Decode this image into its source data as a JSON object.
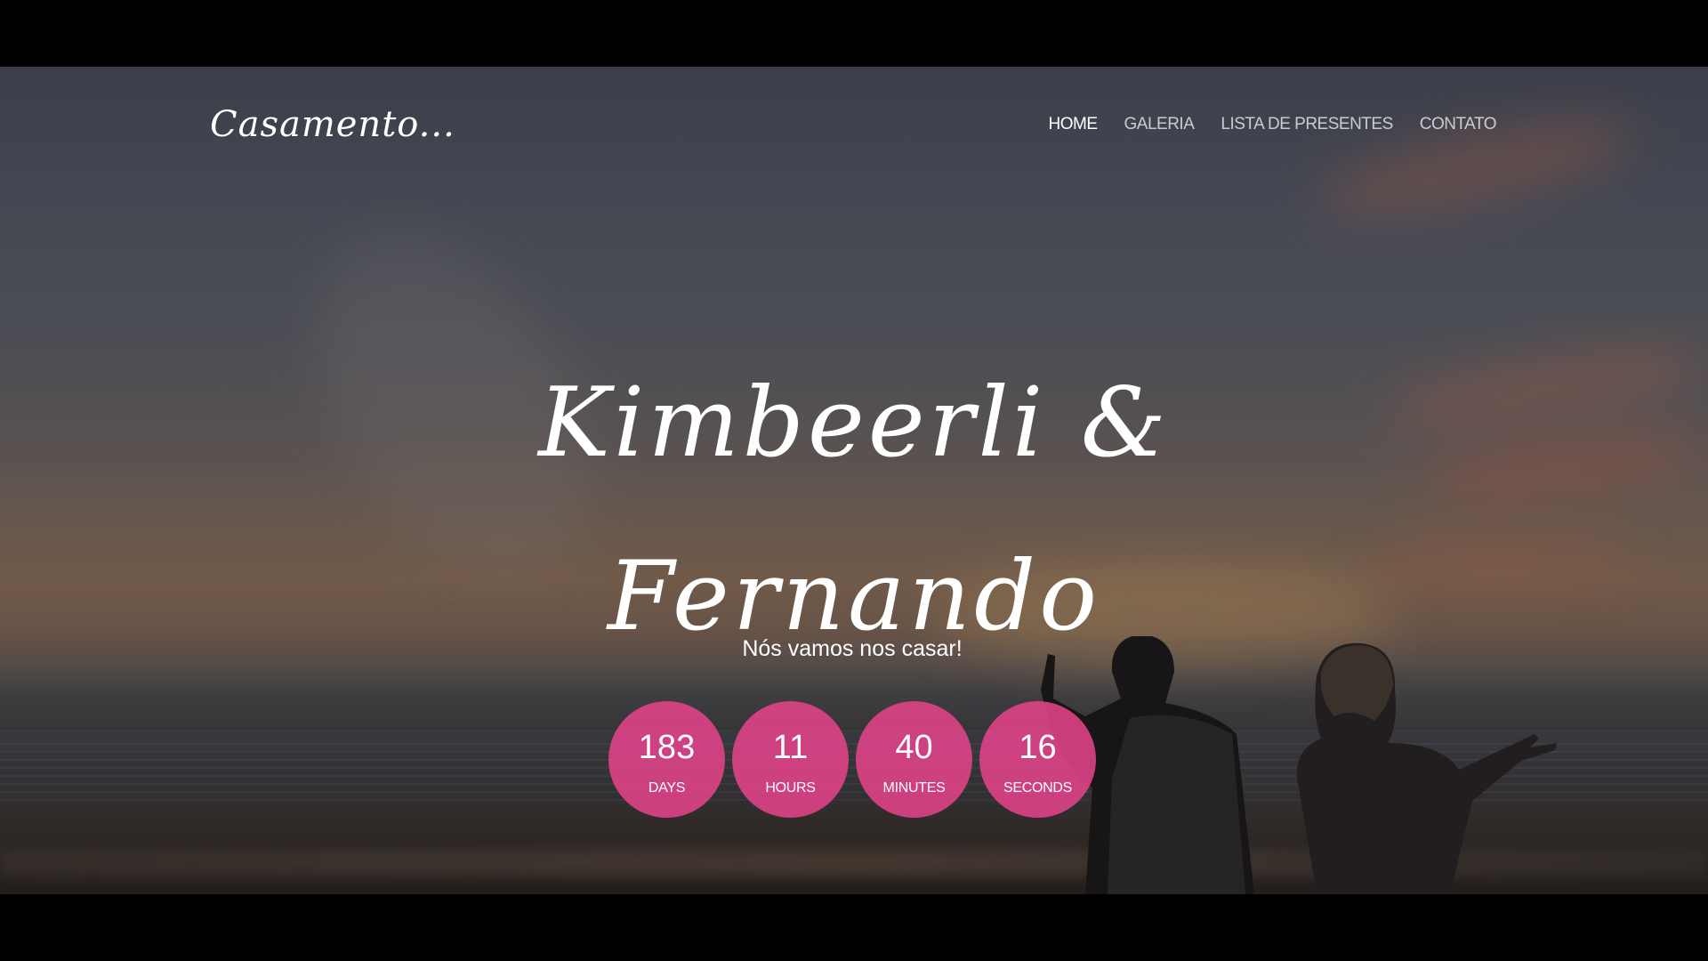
{
  "site": {
    "logo": "Casamento...",
    "nav": {
      "items": [
        {
          "label": "HOME",
          "active": true
        },
        {
          "label": "GALERIA",
          "active": false
        },
        {
          "label": "LISTA DE PRESENTES",
          "active": false
        },
        {
          "label": "CONTATO",
          "active": false
        }
      ]
    }
  },
  "hero": {
    "title_line_1": "Kimbeerli &",
    "title_line_2": "Fernando",
    "subtitle": "Nós vamos nos casar!"
  },
  "countdown": {
    "accent_color": "#e2438a",
    "units": [
      {
        "value": "183",
        "label": "DAYS"
      },
      {
        "value": "11",
        "label": "HOURS"
      },
      {
        "value": "40",
        "label": "MINUTES"
      },
      {
        "value": "16",
        "label": "SECONDS"
      }
    ]
  }
}
